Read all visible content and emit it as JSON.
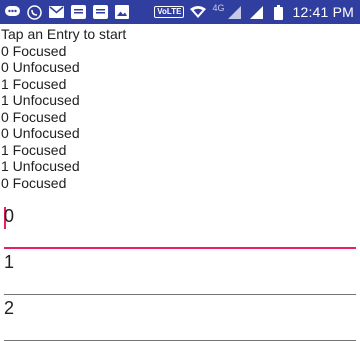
{
  "status_bar": {
    "notification_icons": [
      "chat-bubble-icon",
      "whatsapp-icon",
      "gmail-icon",
      "news-icon",
      "news-icon",
      "gallery-icon"
    ],
    "volte_label": "VoLTE",
    "network_label": "4G",
    "time": "12:41 PM",
    "background_color": "#303f9f"
  },
  "heading": "Tap an Entry to start",
  "log": [
    "0 Focused",
    "0 Unfocused",
    "1 Focused",
    "1 Unfocused",
    "0 Focused",
    "0 Unfocused",
    "1 Focused",
    "1 Unfocused",
    "0 Focused"
  ],
  "entries": [
    {
      "value": "0",
      "focused": true
    },
    {
      "value": "1",
      "focused": false
    },
    {
      "value": "2",
      "focused": false
    }
  ],
  "accent_color": "#e91e63"
}
